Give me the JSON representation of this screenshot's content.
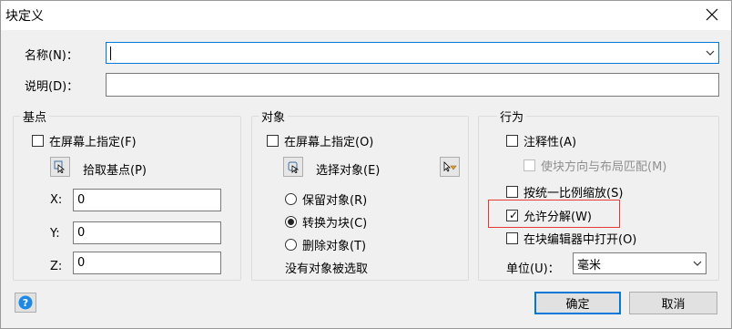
{
  "window": {
    "title": "块定义"
  },
  "name_field": {
    "label": "名称(N)：",
    "value": ""
  },
  "desc_field": {
    "label": "说明(D)：",
    "value": ""
  },
  "basepoint": {
    "title": "基点",
    "specify_on_screen": "在屏幕上指定(F)",
    "pick_label": "拾取基点(P)",
    "x_label": "X:",
    "x_value": "0",
    "y_label": "Y:",
    "y_value": "0",
    "z_label": "Z:",
    "z_value": "0"
  },
  "objects": {
    "title": "对象",
    "specify_on_screen": "在屏幕上指定(O)",
    "select_label": "选择对象(E)",
    "retain": "保留对象(R)",
    "convert": "转换为块(C)",
    "delete": "删除对象(T)",
    "status": "没有对象被选取"
  },
  "behavior": {
    "title": "行为",
    "annotative": "注释性(A)",
    "match_orientation": "使块方向与布局匹配(M)",
    "scale_uniformly": "按统一比例缩放(S)",
    "allow_exploding": "允许分解(W)",
    "open_in_editor": "在块编辑器中打开(O)",
    "units_label": "单位(U)：",
    "units_value": "毫米"
  },
  "buttons": {
    "ok": "确定",
    "cancel": "取消"
  },
  "colors": {
    "accent": "#0078d7",
    "highlight": "#e53935",
    "help": "#1e88e5"
  }
}
